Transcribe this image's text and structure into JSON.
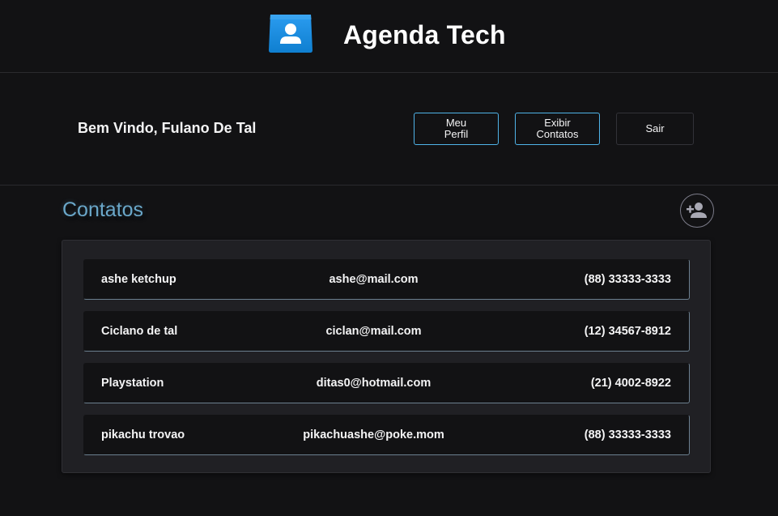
{
  "header": {
    "title": "Agenda Tech",
    "logo_icon": "contact-card-icon",
    "logo_color": "#1e90e0"
  },
  "welcome": {
    "text": "Bem Vindo, Fulano De Tal"
  },
  "nav": {
    "profile_label": "Meu\nPerfil",
    "contacts_label": "Exibir\nContatos",
    "logout_label": "Sair"
  },
  "contacts": {
    "title": "Contatos",
    "add_icon": "add-person-icon",
    "items": [
      {
        "name": "ashe ketchup",
        "email": "ashe@mail.com",
        "phone": "(88) 33333-3333"
      },
      {
        "name": "Ciclano de tal",
        "email": "ciclan@mail.com",
        "phone": "(12) 34567-8912"
      },
      {
        "name": "Playstation",
        "email": "ditas0@hotmail.com",
        "phone": "(21) 4002-8922"
      },
      {
        "name": "pikachu trovao",
        "email": "pikachuashe@poke.mom",
        "phone": "(88) 33333-3333"
      }
    ]
  },
  "colors": {
    "background": "#121214",
    "panel": "#202024",
    "accent_blue": "#4fb3e8",
    "section_title": "#6aa7c9"
  }
}
